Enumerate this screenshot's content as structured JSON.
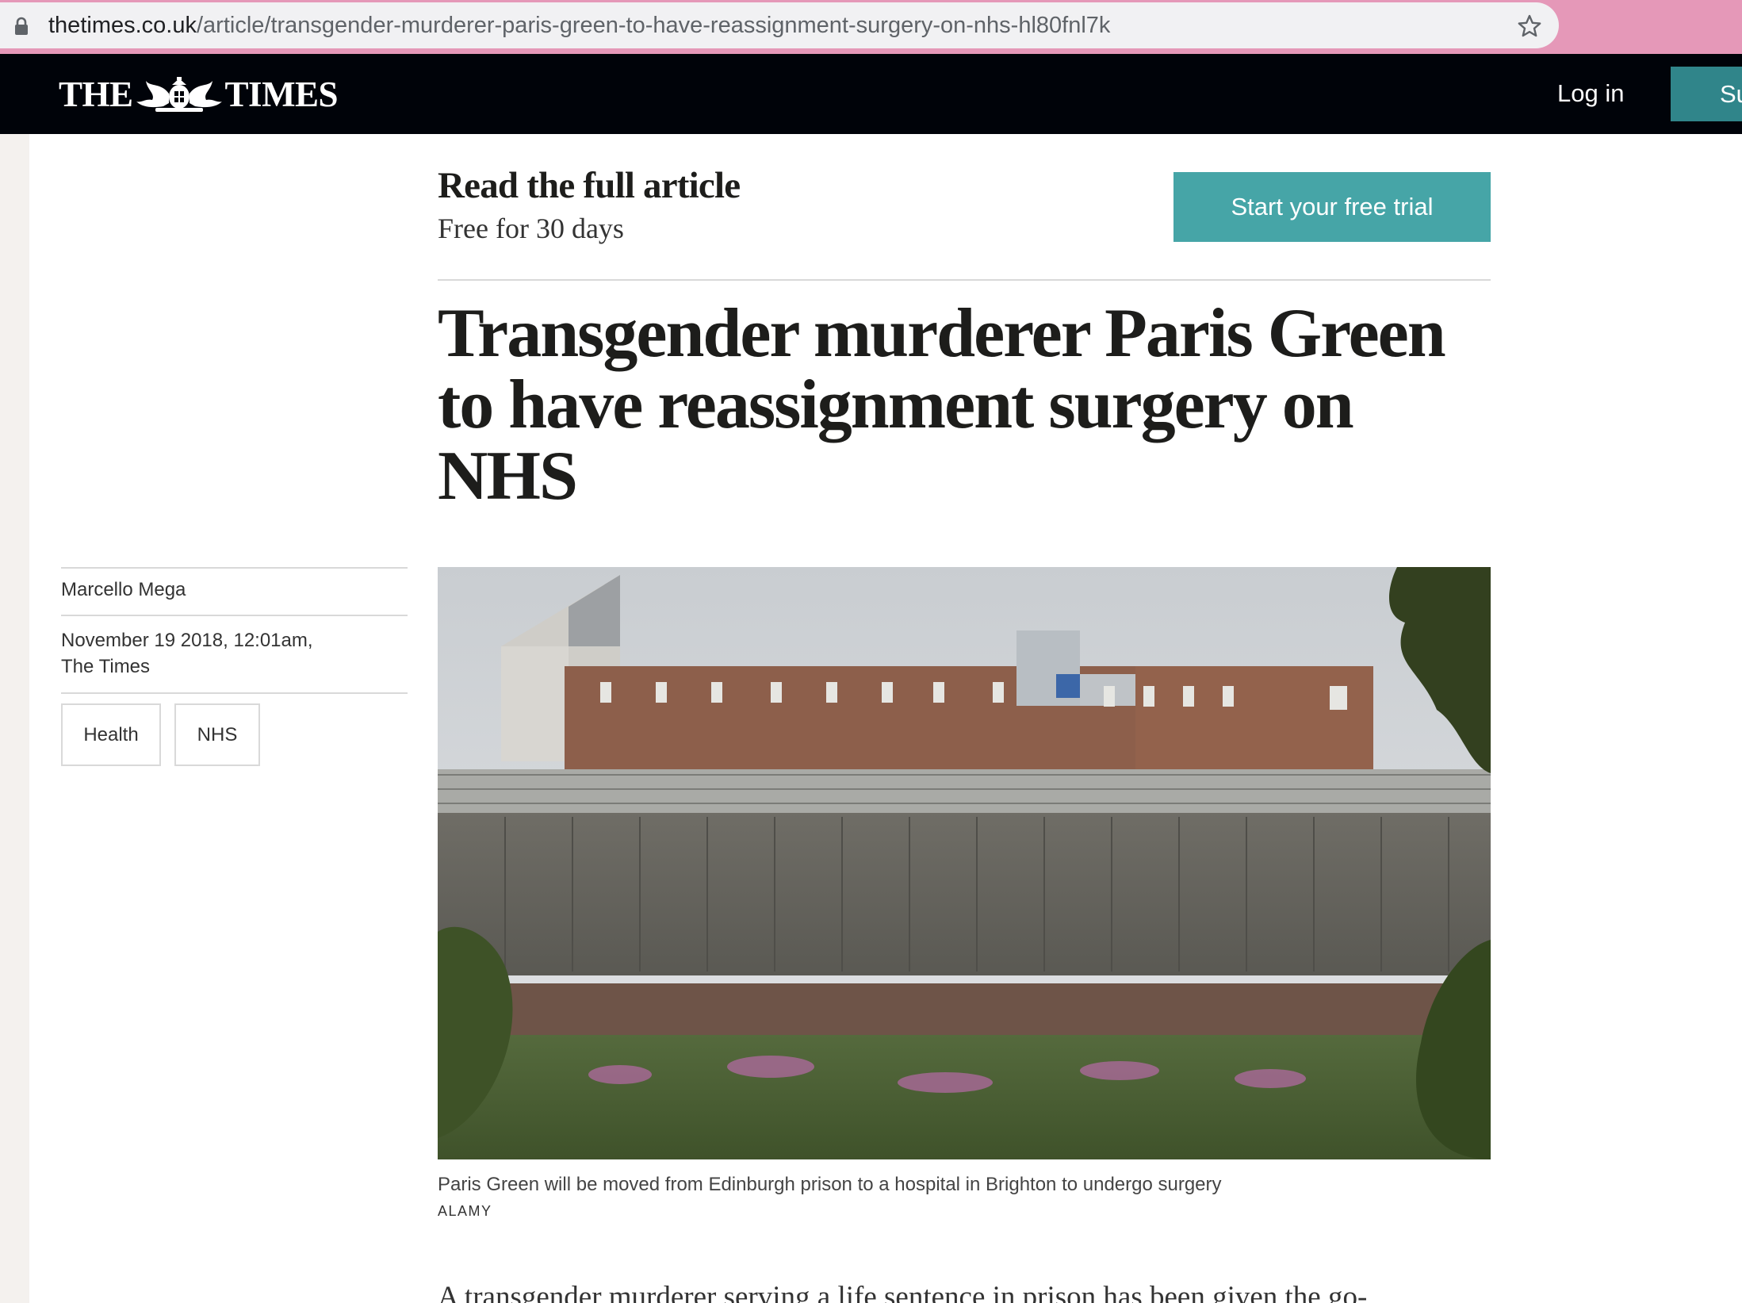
{
  "browser": {
    "url_host": "thetimes.co.uk",
    "url_path": "/article/transgender-murderer-paris-green-to-have-reassignment-surgery-on-nhs-hl80fnl7k"
  },
  "header": {
    "logo_left": "THE",
    "logo_right": "TIMES",
    "login_label": "Log in",
    "subscribe_label": "Su"
  },
  "promo": {
    "title": "Read the full article",
    "subtitle": "Free for 30 days",
    "cta_label": "Start your free trial"
  },
  "article": {
    "headline": "Transgender murderer Paris Green to have reassignment surgery on NHS",
    "author": "Marcello Mega",
    "date": "November 19 2018, 12:01am,",
    "publication": "The Times",
    "tags": [
      "Health",
      "NHS"
    ],
    "caption": "Paris Green will be moved from Edinburgh prison to a hospital in Brighton to undergo surgery",
    "credit": "ALAMY",
    "body_first_line": "A transgender murderer serving a life sentence in prison has been given the go-"
  },
  "colors": {
    "header_bg": "#000309",
    "accent_teal": "#46a5a7",
    "browser_bar": "#e598b8"
  },
  "icons": [
    "lock-icon",
    "star-icon",
    "times-crest-logo"
  ]
}
